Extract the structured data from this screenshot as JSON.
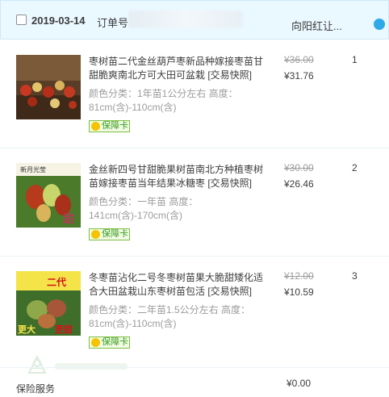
{
  "order": {
    "date": "2019-03-14",
    "order_no_label": "订单号",
    "shop_name": "向阳红让..."
  },
  "items": [
    {
      "title": "枣树苗二代金丝葫芦枣新品种嫁接枣苗甘甜脆爽南北方可大田可盆栽 [交易快照]",
      "attrs": "颜色分类：1年苗1公分左右  高度：81cm(含)-110cm(含)",
      "badge": "保障卡",
      "original_price": "¥36.00",
      "price": "¥31.76",
      "qty": "1"
    },
    {
      "title": "金丝新四号甘甜脆果树苗南北方种植枣树苗嫁接枣苗当年结果冰糖枣 [交易快照]",
      "attrs": "颜色分类：一年苗  高度：141cm(含)-170cm(含)",
      "badge": "保障卡",
      "original_price": "¥30.00",
      "price": "¥26.46",
      "qty": "2"
    },
    {
      "title": "冬枣苗沾化二号冬枣树苗果大脆甜矮化适合大田盆栽山东枣树苗包活 [交易快照]",
      "attrs": "颜色分类：二年苗1.5公分左右  高度：81cm(含)-110cm(含)",
      "badge": "保障卡",
      "original_price": "¥12.00",
      "price": "¥10.59",
      "qty": "3"
    }
  ],
  "thumb_texts": {
    "item2_top": "新月光莹",
    "item2_sweet": "甜",
    "item3_top": "二代",
    "item3_bottom_1": "更大",
    "item3_bottom_2": "更甜"
  },
  "service": {
    "label": "保险服务",
    "fee": "¥0.00"
  },
  "colors": {
    "header_bg": "#eaf8ff",
    "badge_green": "#3a9d1f",
    "muted": "#9c9c9c"
  }
}
